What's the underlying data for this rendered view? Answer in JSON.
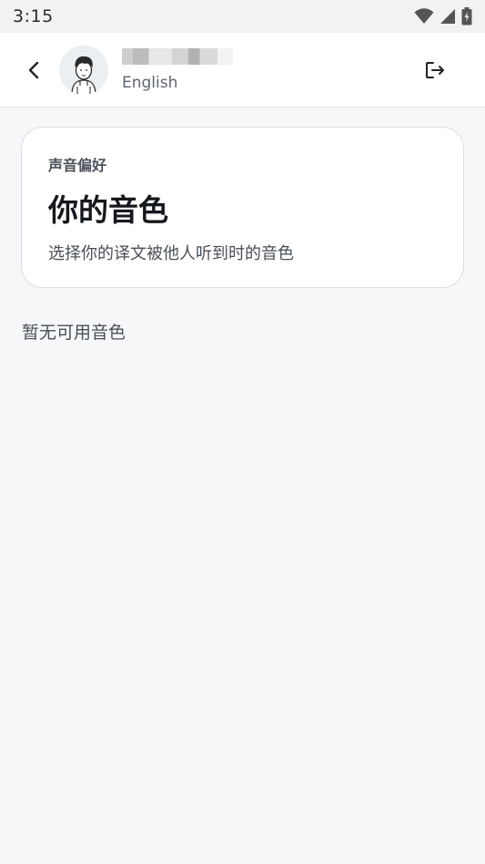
{
  "status_bar": {
    "time": "3:15",
    "icons": [
      "wifi-icon",
      "cellular-signal-icon",
      "battery-charging-icon"
    ]
  },
  "header": {
    "back_icon": "chevron-left-icon",
    "avatar_icon": "user-avatar-illustration",
    "user_language": "English",
    "logout_icon": "logout-icon"
  },
  "voice_card": {
    "eyebrow": "声音偏好",
    "title": "你的音色",
    "description": "选择你的译文被他人听到时的音色"
  },
  "empty_state": {
    "message": "暂无可用音色"
  },
  "colors": {
    "background": "#f6f7f9",
    "card": "#ffffff",
    "text_primary": "#15181c",
    "text_secondary": "#4a4f57"
  }
}
